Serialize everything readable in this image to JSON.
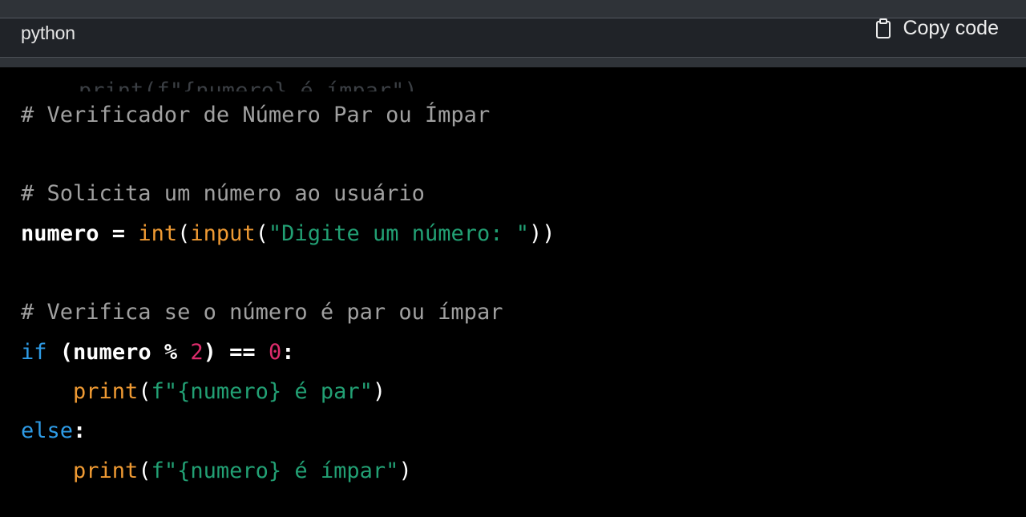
{
  "header": {
    "language": "python",
    "copy_label": "Copy code",
    "copy_icon": "clipboard-icon"
  },
  "ghost_text": "print(f\"{numero} é ímpar\")",
  "code": {
    "line1": {
      "comment": "# Verificador de Número Par ou Ímpar"
    },
    "line2": {
      "comment": "# Solicita um número ao usuário"
    },
    "line3": {
      "var": "numero",
      "op": " = ",
      "fn1": "int",
      "p1": "(",
      "fn2": "input",
      "p2": "(",
      "str": "\"Digite um número: \"",
      "p3": "))"
    },
    "line4": {
      "comment": "# Verifica se o número é par ou ímpar"
    },
    "line5": {
      "kw": "if",
      "sp": " ",
      "p1": "(",
      "var": "numero",
      "op": " % ",
      "n1": "2",
      "p2": ")",
      "eq": " == ",
      "n2": "0",
      "colon": ":"
    },
    "line6": {
      "indent": "    ",
      "fn": "print",
      "p1": "(",
      "str": "f\"{numero} é par\"",
      "p2": ")"
    },
    "line7": {
      "kw": "else",
      "colon": ":"
    },
    "line8": {
      "indent": "    ",
      "fn": "print",
      "p1": "(",
      "str": "f\"{numero} é ímpar\"",
      "p2": ")"
    }
  },
  "colors": {
    "background": "#000000",
    "header_bg": "#202328",
    "comment": "#a0a0a0",
    "builtin": "#ef9a33",
    "string": "#22a074",
    "number": "#dd2c6c",
    "keyword": "#2e9be6"
  }
}
